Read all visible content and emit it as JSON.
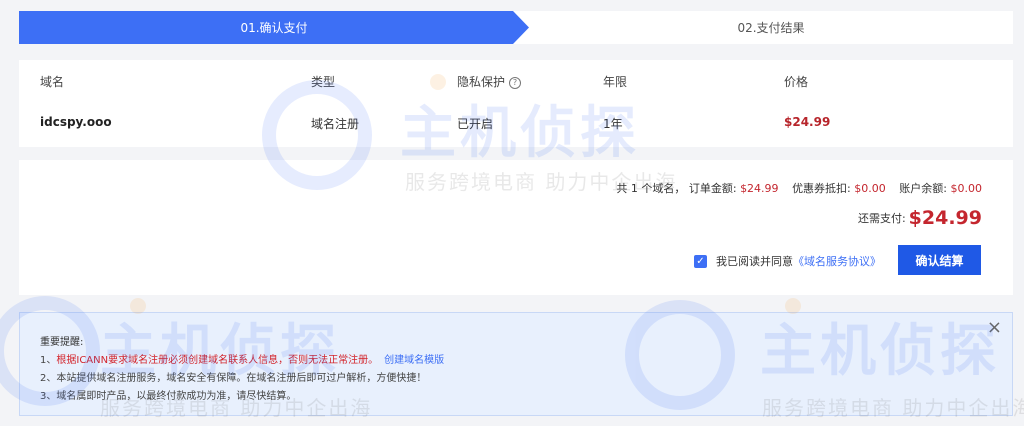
{
  "steps": {
    "step1_label": "01.确认支付",
    "step2_label": "02.支付结果"
  },
  "table": {
    "headers": {
      "domain": "域名",
      "type": "类型",
      "privacy": "隐私保护",
      "term": "年限",
      "price": "价格"
    },
    "help_symbol": "?",
    "row": {
      "domain": "idcspy.ooo",
      "type": "域名注册",
      "privacy": "已开启",
      "term": "1年",
      "price": "$24.99"
    }
  },
  "summary": {
    "count_prefix": "共 1 个域名，",
    "order_label": "订单金额:",
    "order_value": "$24.99",
    "coupon_label": "优惠券抵扣:",
    "coupon_value": "$0.00",
    "balance_label": "账户余额:",
    "balance_value": "$0.00",
    "due_label": "还需支付:",
    "due_value": "$24.99",
    "agree_text": "我已阅读并同意",
    "agree_link": "《域名服务协议》",
    "checkbox_mark": "✓",
    "confirm_label": "确认结算"
  },
  "notice": {
    "title": "重要提醒:",
    "line1_prefix": "1、",
    "line1_red": "根据ICANN要求域名注册必须创建域名联系人信息，否则无法正常注册。",
    "line1_link": "创建域名模版",
    "line2": "2、本站提供域名注册服务，域名安全有保障。在域名注册后即可过户解析，方便快捷！",
    "line3": "3、域名属即时产品，以最终付款成功为准，请尽快结算。",
    "close_symbol": "×"
  },
  "watermark": {
    "brand": "主机侦探",
    "slogan": "服务跨境电商 助力中企出海"
  },
  "colors": {
    "primary": "#3d6ff5",
    "button": "#1f59e6",
    "price_red": "#c4262e",
    "notice_bg": "#e8f0fd"
  }
}
